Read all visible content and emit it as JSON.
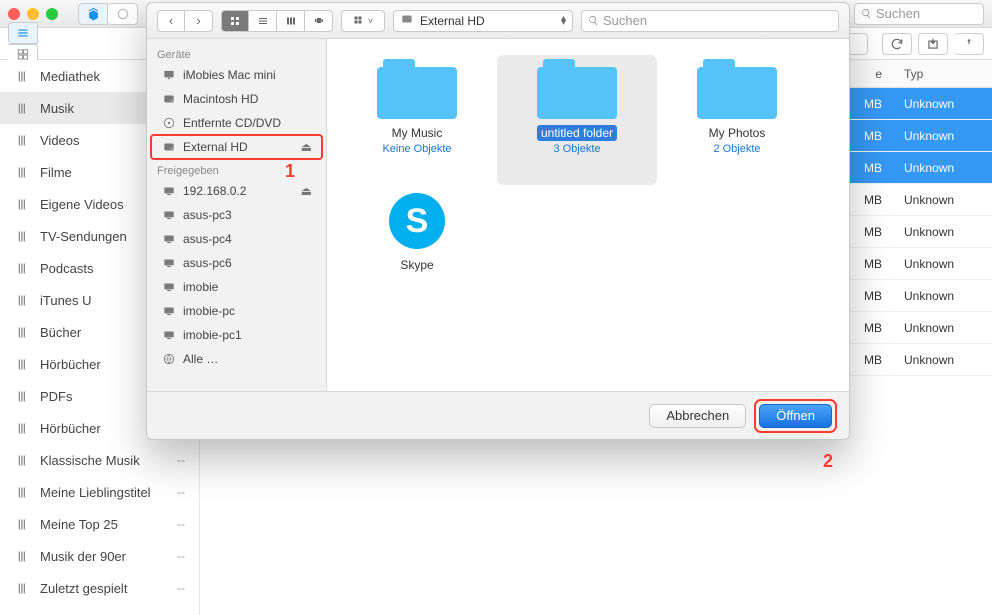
{
  "window": {
    "search_placeholder": "Suchen"
  },
  "subbar": {
    "search_placeholder": "Suchen"
  },
  "sidebar": {
    "items": [
      {
        "label": "Mediathek",
        "badge": ""
      },
      {
        "label": "Musik",
        "badge": ""
      },
      {
        "label": "Videos",
        "badge": ""
      },
      {
        "label": "Filme",
        "badge": ""
      },
      {
        "label": "Eigene Videos",
        "badge": ""
      },
      {
        "label": "TV-Sendungen",
        "badge": ""
      },
      {
        "label": "Podcasts",
        "badge": ""
      },
      {
        "label": "iTunes U",
        "badge": ""
      },
      {
        "label": "Bücher",
        "badge": ""
      },
      {
        "label": "Hörbücher",
        "badge": ""
      },
      {
        "label": "PDFs",
        "badge": ""
      },
      {
        "label": "Hörbücher",
        "badge": "--"
      },
      {
        "label": "Klassische Musik",
        "badge": "--"
      },
      {
        "label": "Meine Lieblingstitel",
        "badge": "--"
      },
      {
        "label": "Meine Top 25",
        "badge": "--"
      },
      {
        "label": "Musik der 90er",
        "badge": "--"
      },
      {
        "label": "Zuletzt gespielt",
        "badge": "--"
      }
    ],
    "selected_index": 1
  },
  "table": {
    "columns": {
      "size": "e",
      "type": "Typ"
    },
    "rows": [
      {
        "size": "MB",
        "type": "Unknown",
        "selected": true
      },
      {
        "size": "MB",
        "type": "Unknown",
        "selected": true
      },
      {
        "size": "MB",
        "type": "Unknown",
        "selected": true
      },
      {
        "size": "MB",
        "type": "Unknown",
        "selected": false
      },
      {
        "size": "MB",
        "type": "Unknown",
        "selected": false
      },
      {
        "size": "MB",
        "type": "Unknown",
        "selected": false
      },
      {
        "size": "MB",
        "type": "Unknown",
        "selected": false
      },
      {
        "size": "MB",
        "type": "Unknown",
        "selected": false
      },
      {
        "size": "MB",
        "type": "Unknown",
        "selected": false
      }
    ]
  },
  "dialog": {
    "location": "External HD",
    "search_placeholder": "Suchen",
    "sidebar": {
      "devices_header": "Geräte",
      "devices": [
        {
          "label": "iMobies Mac mini",
          "icon": "imac"
        },
        {
          "label": "Macintosh HD",
          "icon": "hdd"
        },
        {
          "label": "Entfernte CD/DVD",
          "icon": "cd"
        },
        {
          "label": "External HD",
          "icon": "hdd",
          "eject": true,
          "highlight": true
        }
      ],
      "shared_header": "Freigegeben",
      "shared": [
        {
          "label": "192.168.0.2",
          "icon": "display",
          "eject": true
        },
        {
          "label": "asus-pc3",
          "icon": "display"
        },
        {
          "label": "asus-pc4",
          "icon": "display"
        },
        {
          "label": "asus-pc6",
          "icon": "display"
        },
        {
          "label": "imobie",
          "icon": "display"
        },
        {
          "label": "imobie-pc",
          "icon": "display"
        },
        {
          "label": "imobie-pc1",
          "icon": "display"
        },
        {
          "label": "Alle …",
          "icon": "globe"
        }
      ]
    },
    "tiles": [
      {
        "kind": "folder",
        "label": "My Music",
        "sub": "Keine Objekte",
        "selected": false
      },
      {
        "kind": "folder",
        "label": "untitled folder",
        "sub": "3 Objekte",
        "selected": true
      },
      {
        "kind": "folder",
        "label": "My Photos",
        "sub": "2 Objekte",
        "selected": false
      },
      {
        "kind": "app",
        "label": "Skype",
        "sub": "",
        "selected": false,
        "glyph": "S"
      }
    ],
    "footer": {
      "cancel": "Abbrechen",
      "open": "Öffnen"
    },
    "callouts": {
      "one": "1",
      "two": "2"
    }
  }
}
